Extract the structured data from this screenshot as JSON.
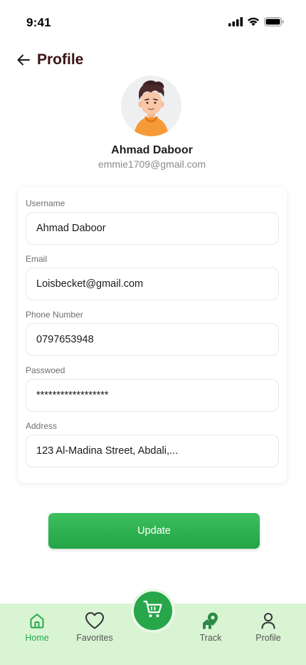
{
  "status_bar": {
    "time": "9:41"
  },
  "header": {
    "title": "Profile"
  },
  "profile": {
    "name": "Ahmad Daboor",
    "email": "emmie1709@gmail.com"
  },
  "form": {
    "username": {
      "label": "Username",
      "value": "Ahmad Daboor"
    },
    "email": {
      "label": "Email",
      "value": "Loisbecket@gmail.com"
    },
    "phone": {
      "label": "Phone Number",
      "value": "0797653948"
    },
    "password": {
      "label": "Passwoed",
      "value": "******************"
    },
    "address": {
      "label": "Address",
      "value": "123 Al-Madina Street, Abdali,..."
    }
  },
  "update_button": {
    "label": "Update"
  },
  "bottom_nav": {
    "items": [
      {
        "label": "Home",
        "icon": "home-icon",
        "active": true
      },
      {
        "label": "Favorites",
        "icon": "heart-icon",
        "active": false
      },
      {
        "label": "Track",
        "icon": "track-location-icon",
        "active": false
      },
      {
        "label": "Profile",
        "icon": "user-icon",
        "active": false
      }
    ],
    "center_button_icon": "cart-icon"
  },
  "colors": {
    "accent_green": "#27a64a",
    "nav_background": "#d8f4d3",
    "title_color": "#3b1414"
  }
}
